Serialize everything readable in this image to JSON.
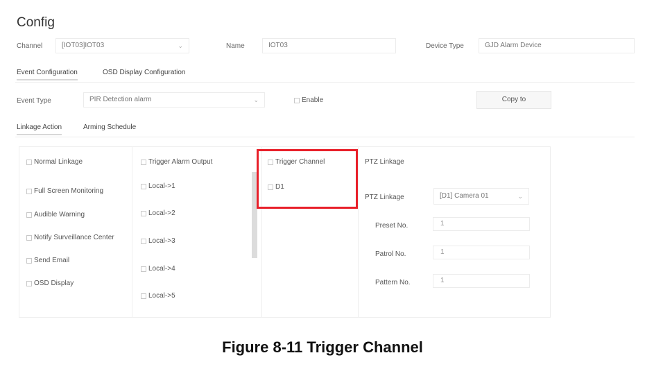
{
  "page": {
    "title": "Config"
  },
  "top_row": {
    "channel_label": "Channel",
    "channel_value": "[IOT03]IOT03",
    "name_label": "Name",
    "name_value": "IOT03",
    "device_type_label": "Device Type",
    "device_type_value": "GJD Alarm Device"
  },
  "main_tabs": [
    {
      "label": "Event Configuration",
      "active": true
    },
    {
      "label": "OSD Display Configuration",
      "active": false
    }
  ],
  "event_row": {
    "event_type_label": "Event Type",
    "event_type_value": "PIR Detection alarm",
    "enable_label": "Enable",
    "copy_button": "Copy to"
  },
  "sub_tabs": [
    {
      "label": "Linkage Action",
      "active": true
    },
    {
      "label": "Arming Schedule",
      "active": false
    }
  ],
  "normal_linkage": {
    "header": "Normal Linkage",
    "items": [
      {
        "label": "Full Screen Monitoring",
        "checked": false
      },
      {
        "label": "Audible Warning",
        "checked": false
      },
      {
        "label": "Notify Surveillance Center",
        "checked": false
      },
      {
        "label": "Send Email",
        "checked": false
      },
      {
        "label": "OSD Display",
        "checked": false
      }
    ]
  },
  "trigger_alarm_output": {
    "header": "Trigger Alarm Output",
    "items": [
      {
        "label": "Local->1"
      },
      {
        "label": "Local->2"
      },
      {
        "label": "Local->3"
      },
      {
        "label": "Local->4"
      },
      {
        "label": "Local->5"
      }
    ]
  },
  "trigger_channel": {
    "header": "Trigger Channel",
    "items": [
      {
        "label": "D1"
      }
    ]
  },
  "ptz": {
    "header": "PTZ Linkage",
    "linkage_label": "PTZ Linkage",
    "linkage_value": "[D1] Camera 01",
    "preset_label": "Preset No.",
    "preset_value": "1",
    "patrol_label": "Patrol No.",
    "patrol_value": "1",
    "pattern_label": "Pattern No.",
    "pattern_value": "1"
  },
  "caption": "Figure 8-11 Trigger Channel",
  "colors": {
    "highlight": "#e8202a",
    "border": "#eeeeee"
  }
}
